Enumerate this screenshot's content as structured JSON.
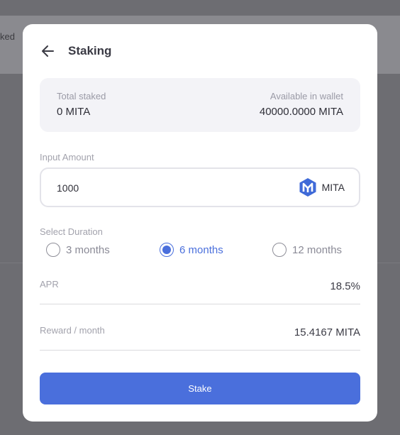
{
  "background": {
    "partial_text": "ked"
  },
  "modal": {
    "title": "Staking",
    "summary": {
      "total_staked_label": "Total staked",
      "total_staked_value": "0 MITA",
      "available_label": "Available in wallet",
      "available_value": "40000.0000 MITA"
    },
    "amount": {
      "label": "Input Amount",
      "value": "1000",
      "token": "MITA"
    },
    "duration": {
      "label": "Select Duration",
      "options": [
        "3 months",
        "6 months",
        "12 months"
      ],
      "selected": "6 months"
    },
    "apr": {
      "label": "APR",
      "value": "18.5%"
    },
    "reward": {
      "label": "Reward / month",
      "value": "15.4167 MITA"
    },
    "stake_button": "Stake"
  },
  "colors": {
    "accent": "#4a6fdc",
    "token_logo": "#3f6ad8",
    "overlay": "#6d6d72"
  },
  "icons": {
    "back": "arrow-left-icon",
    "token": "mita-logo-icon"
  }
}
